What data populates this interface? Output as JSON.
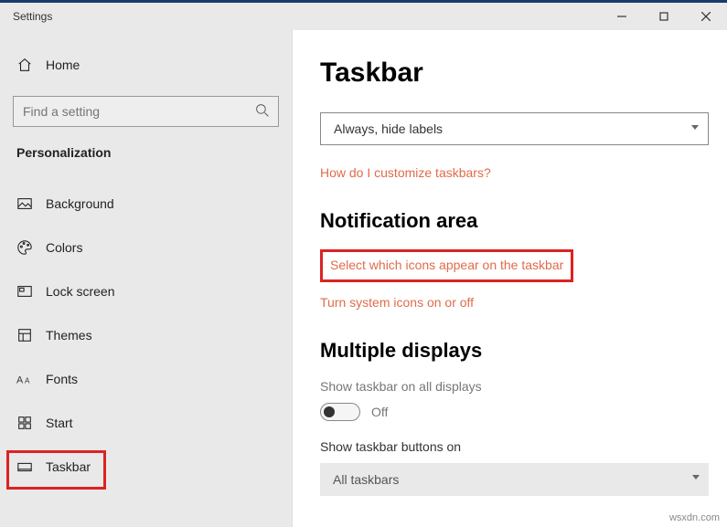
{
  "window": {
    "title": "Settings"
  },
  "sidebar": {
    "home": "Home",
    "search_placeholder": "Find a setting",
    "section": "Personalization",
    "items": [
      {
        "label": "Background"
      },
      {
        "label": "Colors"
      },
      {
        "label": "Lock screen"
      },
      {
        "label": "Themes"
      },
      {
        "label": "Fonts"
      },
      {
        "label": "Start"
      },
      {
        "label": "Taskbar"
      }
    ]
  },
  "content": {
    "title": "Taskbar",
    "combine_dropdown": "Always, hide labels",
    "link_customize": "How do I customize taskbars?",
    "notification_heading": "Notification area",
    "link_select_icons": "Select which icons appear on the taskbar",
    "link_system_icons": "Turn system icons on or off",
    "multiple_heading": "Multiple displays",
    "show_all_label": "Show taskbar on all displays",
    "toggle_state": "Off",
    "show_buttons_label": "Show taskbar buttons on",
    "buttons_dropdown": "All taskbars"
  },
  "watermark": "wsxdn.com"
}
